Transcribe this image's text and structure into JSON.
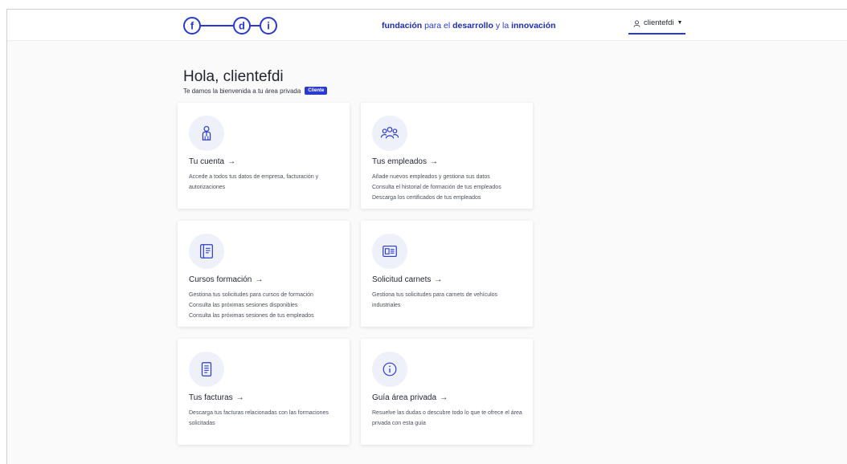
{
  "header": {
    "logo_letters": [
      "f",
      "d",
      "i"
    ],
    "tagline": {
      "part1": "fundación",
      "part2": " para el ",
      "part3": "desarrollo",
      "part4": " y la ",
      "part5": "innovación"
    },
    "user_label": "clientefdi",
    "user_icon": "user-icon",
    "caret_glyph": "▼"
  },
  "main": {
    "greeting": "Hola, clientefdi",
    "welcome_text": "Te damos la bienvenida a tu área privada",
    "badge": "Cliente"
  },
  "cards": [
    {
      "title": "Tu cuenta",
      "arrow": "→",
      "icon": "account-person-icon",
      "lines": [
        "Accede a todos tus datos de empresa, facturación y autorizaciones"
      ]
    },
    {
      "title": "Tus empleados",
      "arrow": "→",
      "icon": "employees-group-icon",
      "lines": [
        "Añade nuevos empleados y gestiona sus datos",
        "Consulta el historial de formación de tus empleados",
        "Descarga los certificados de tus empleados"
      ]
    },
    {
      "title": "Cursos formación",
      "arrow": "→",
      "icon": "training-notebook-icon",
      "lines": [
        "Gestiona tus solicitudes para cursos de formación",
        "Consulta las próximas sesiones disponibles",
        "Consulta las próximas sesiones de tus empleados"
      ]
    },
    {
      "title": "Solicitud carnets",
      "arrow": "→",
      "icon": "id-card-icon",
      "lines": [
        "Gestiona tus solicitudes para carnets de vehículos industriales"
      ]
    },
    {
      "title": "Tus facturas",
      "arrow": "→",
      "icon": "invoice-document-icon",
      "lines": [
        "Descarga tus facturas relacionadas con las formaciones solicitadas"
      ]
    },
    {
      "title": "Guía área privada",
      "arrow": "→",
      "icon": "info-circle-icon",
      "lines": [
        "Resuelve las dudas o descubre todo lo que te ofrece el área privada con esta guía"
      ]
    }
  ],
  "colors": {
    "brand_blue": "#2a3ad0",
    "icon_bg": "#eef0fa",
    "page_bg": "#fafafa"
  }
}
